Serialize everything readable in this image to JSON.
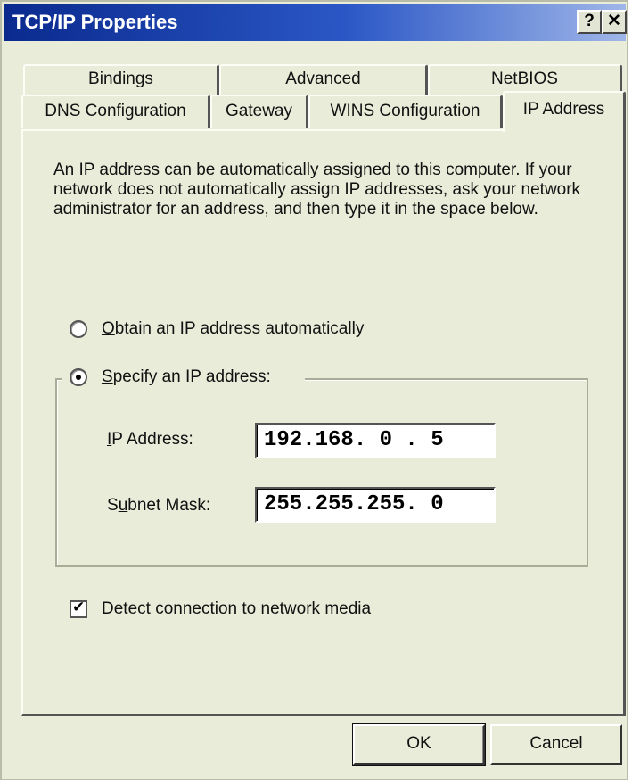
{
  "window": {
    "title": "TCP/IP Properties",
    "help_label": "?",
    "close_label": "✕"
  },
  "tabs": {
    "back_row": [
      "Bindings",
      "Advanced",
      "NetBIOS"
    ],
    "front_row": [
      "DNS Configuration",
      "Gateway",
      "WINS Configuration"
    ],
    "active": "IP Address"
  },
  "ip_page": {
    "description": "An IP address can be automatically assigned to this computer. If your network does not automatically assign IP addresses, ask your network administrator for an address, and then type it in the space below.",
    "obtain_auto": {
      "accel": "O",
      "rest": "btain an IP address automatically",
      "checked": false
    },
    "specify": {
      "accel": "S",
      "rest": "pecify an IP address:",
      "checked": true
    },
    "ip_address": {
      "label_accel": "I",
      "label_rest": "P Address:",
      "value": "192.168. 0 . 5"
    },
    "subnet_mask": {
      "label_pre": "S",
      "label_accel": "u",
      "label_rest": "bnet Mask:",
      "value": "255.255.255. 0"
    },
    "detect": {
      "accel": "D",
      "rest": "etect connection to network media",
      "checked": true
    }
  },
  "buttons": {
    "ok": "OK",
    "cancel": "Cancel"
  },
  "colors": {
    "dialog_bg": "#e9ecd9",
    "title_bar_start": "#0a2a8e",
    "title_bar_end": "#9fb6e8"
  }
}
